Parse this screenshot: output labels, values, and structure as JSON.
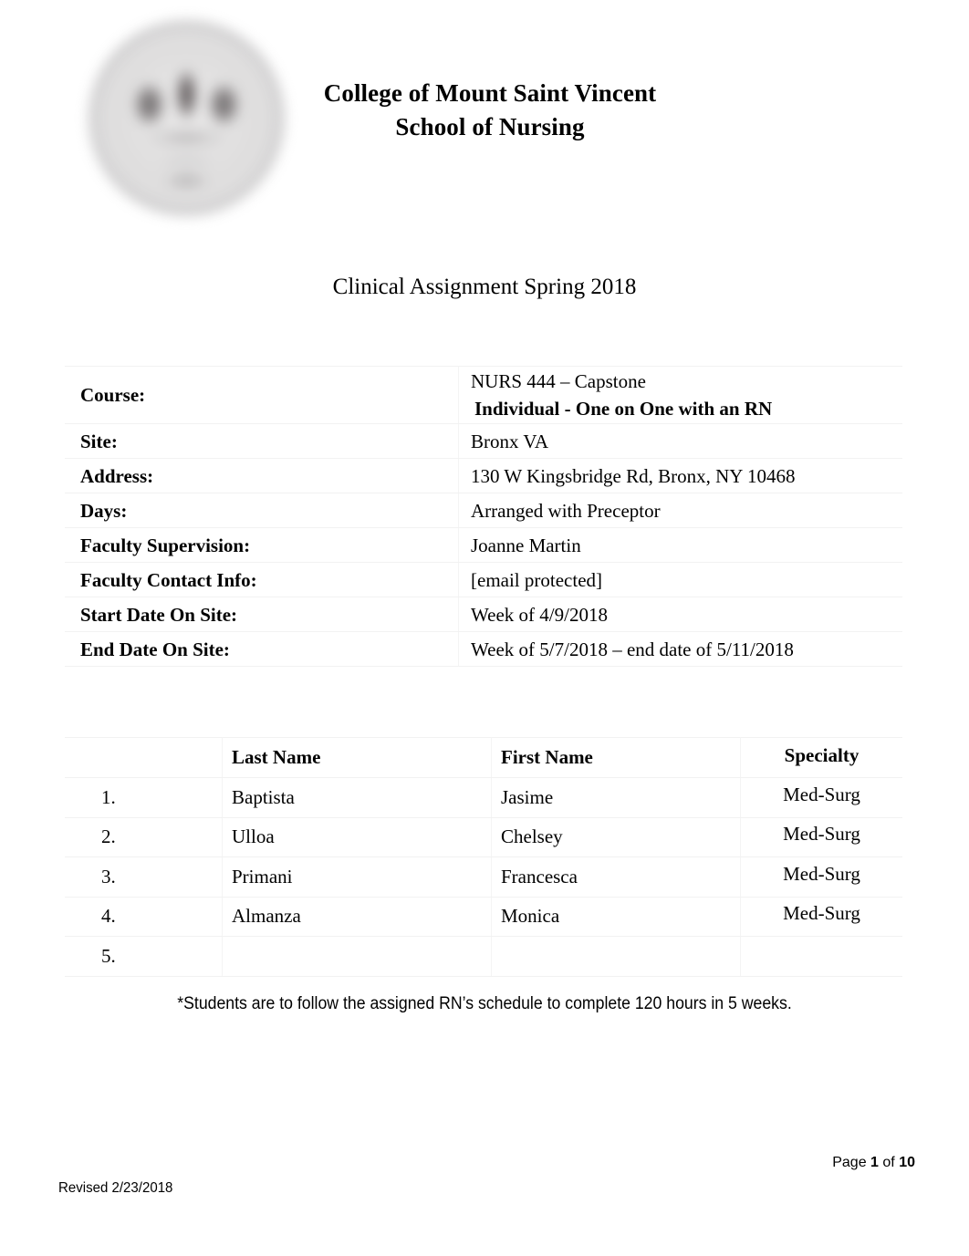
{
  "header": {
    "logo_icon": "college-seal-icon",
    "institution_line1": "College of Mount Saint Vincent",
    "institution_line2": "School of Nursing"
  },
  "document": {
    "title": "Clinical Assignment Spring 2018"
  },
  "info_table": {
    "rows": [
      {
        "label": "Course:",
        "value": "NURS 444 – Capstone",
        "value_bold_line": " Individual - One on One with an RN"
      },
      {
        "label": "Site:",
        "value": "Bronx VA"
      },
      {
        "label": "Address:",
        "value": "130 W Kingsbridge Rd, Bronx, NY 10468"
      },
      {
        "label": "Days:",
        "value": "Arranged with Preceptor"
      },
      {
        "label": "Faculty Supervision:",
        "value": "Joanne Martin"
      },
      {
        "label": "Faculty Contact Info:",
        "value": "[email protected]"
      },
      {
        "label": "Start Date On Site:",
        "value": "Week of 4/9/2018"
      },
      {
        "label": "End Date On Site:",
        "value": "Week of 5/7/2018 – end date of 5/11/2018"
      }
    ]
  },
  "roster_table": {
    "headers": {
      "number": "",
      "last_name": "Last Name",
      "first_name": "First Name",
      "specialty": "Specialty"
    },
    "rows": [
      {
        "number": "1.",
        "last_name": "Baptista",
        "first_name": "Jasime",
        "specialty": "Med-Surg"
      },
      {
        "number": "2.",
        "last_name": "Ulloa",
        "first_name": "Chelsey",
        "specialty": "Med-Surg"
      },
      {
        "number": "3.",
        "last_name": "Primani",
        "first_name": "Francesca",
        "specialty": "Med-Surg"
      },
      {
        "number": "4.",
        "last_name": "Almanza",
        "first_name": "Monica",
        "specialty": "Med-Surg"
      },
      {
        "number": "5.",
        "last_name": "",
        "first_name": "",
        "specialty": ""
      }
    ]
  },
  "footnote": {
    "text": "*Students are to follow the assigned RN’s schedule to complete 120 hours in 5 weeks."
  },
  "footer": {
    "page_word": "Page",
    "page_number": "1",
    "of_word": "of",
    "page_total": "10",
    "revised": "Revised 2/23/2018"
  }
}
